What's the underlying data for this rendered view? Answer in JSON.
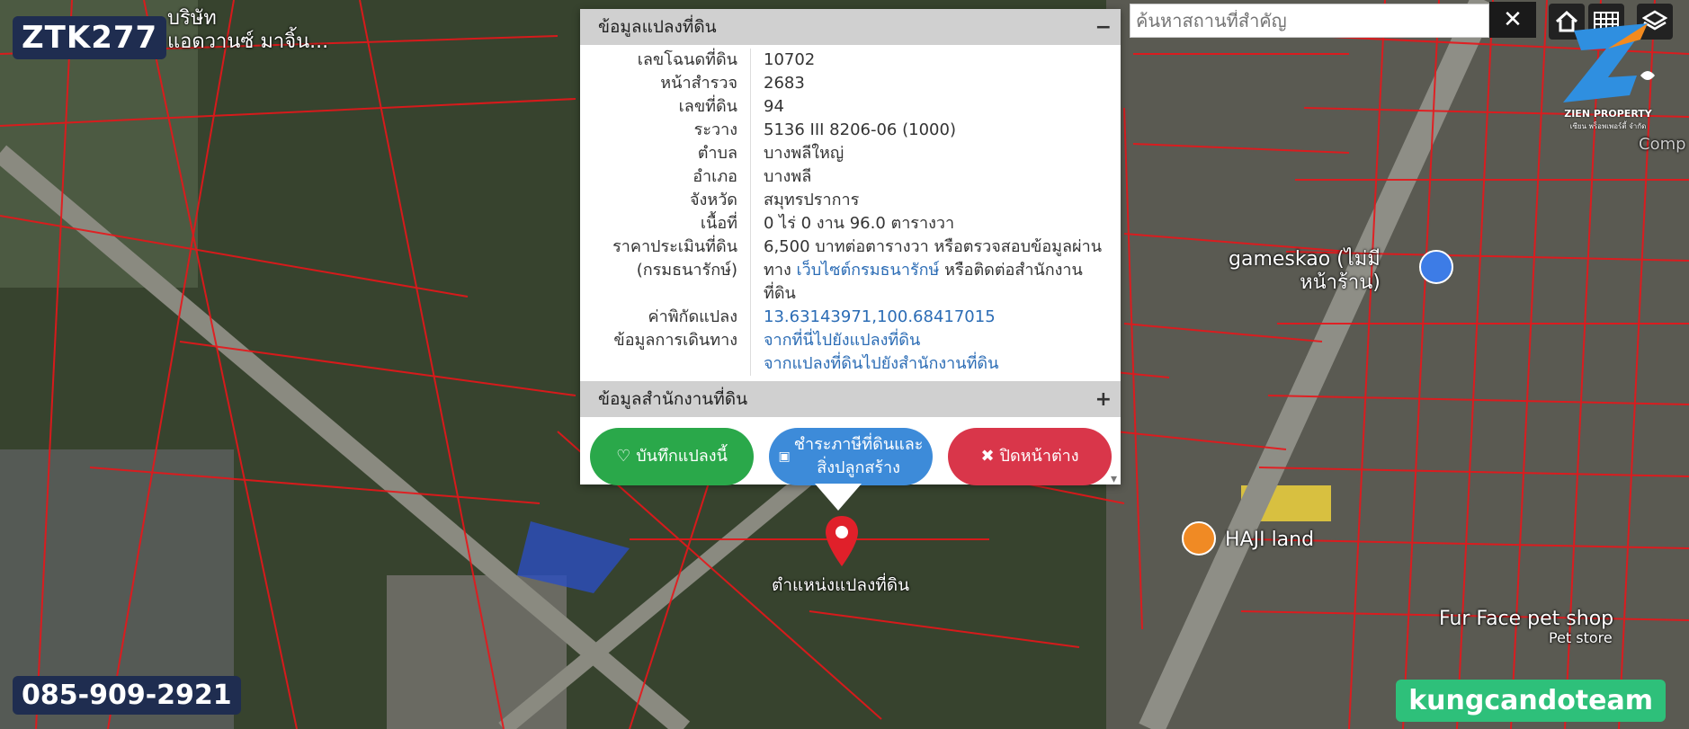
{
  "badges": {
    "code": "ZTK277",
    "phone": "085-909-2921",
    "team": "kungcandoteam"
  },
  "map_labels": {
    "company": "บริษัท\nแอดวานซ์ มาจิ้น...",
    "gameskao": "gameskao (ไม่มี\nหน้าร้าน)",
    "haji": "HAJI land",
    "furface": "Fur Face pet shop",
    "petstore": "Pet store",
    "comp": "Comp"
  },
  "search": {
    "placeholder": "ค้นหาสถานที่สำคัญ",
    "clear": "✕"
  },
  "logo": {
    "brand": "ZIEN PROPERTY",
    "sub": "เซียน พร็อพเพอร์ตี้ จำกัด"
  },
  "popup": {
    "section1_title": "ข้อมูลแปลงที่ดิน",
    "section1_toggle": "−",
    "section2_title": "ข้อมูลสำนักงานที่ดิน",
    "section2_toggle": "+",
    "rows": [
      {
        "label": "เลขโฉนดที่ดิน",
        "value": "10702"
      },
      {
        "label": "หน้าสำรวจ",
        "value": "2683"
      },
      {
        "label": "เลขที่ดิน",
        "value": "94"
      },
      {
        "label": "ระวาง",
        "value": "5136 III 8206-06 (1000)"
      },
      {
        "label": "ตำบล",
        "value": "บางพลีใหญ่"
      },
      {
        "label": "อำเภอ",
        "value": "บางพลี"
      },
      {
        "label": "จังหวัด",
        "value": "สมุทรปราการ"
      },
      {
        "label": "เนื้อที่",
        "value": "0 ไร่ 0 งาน 96.0 ตารางวา"
      },
      {
        "label": "ราคาประเมินที่ดิน",
        "value": "6,500 บาทต่อตารางวา หรือตรวจสอบข้อมูลผ่าน"
      },
      {
        "label": "(กรมธนารักษ์)",
        "value_pre": "ทาง ",
        "value_link": "เว็บไซต์กรมธนารักษ์",
        "value_post": " หรือติดต่อสำนักงานที่ดิน"
      },
      {
        "label": "ค่าพิกัดแปลง",
        "value": "13.63143971,100.68417015"
      },
      {
        "label": "ข้อมูลการเดินทาง",
        "value": "จากที่นี่ไปยังแปลงที่ดิน"
      },
      {
        "label": "",
        "value": "จากแปลงที่ดินไปยังสำนักงานที่ดิน"
      }
    ],
    "buttons": {
      "save": "บันทึกแปลงนี้",
      "pay": "ชำระภาษีที่ดินและ\nสิ่งปลูกสร้าง",
      "close": "ปิดหน้าต่าง"
    },
    "scroll_indicator": "▾"
  },
  "pin_label": "ตำแหน่งแปลงที่ดิน",
  "colors": {
    "plot_line": "#e8161a",
    "save": "#2aa84a",
    "pay": "#3d8bd9",
    "close": "#d9364a",
    "badge": "#1f2d50",
    "team": "#2ec07a"
  }
}
